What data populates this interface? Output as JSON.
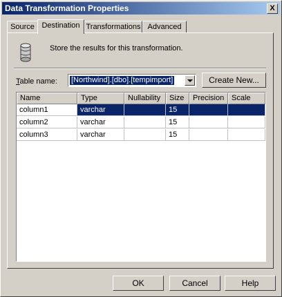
{
  "window": {
    "title": "Data Transformation Properties",
    "close_label": "X"
  },
  "tabs": [
    {
      "label": "Source"
    },
    {
      "label": "Destination",
      "active": true
    },
    {
      "label": "Transformations"
    },
    {
      "label": "Advanced"
    }
  ],
  "destination": {
    "description": "Store the results for this transformation.",
    "table_label_prefix": "T",
    "table_label_rest": "able name:",
    "table_name_value": "[Northwind].[dbo].[tempimport]",
    "create_new_label": "Create New..."
  },
  "grid": {
    "headers": [
      "Name",
      "Type",
      "Nullability",
      "Size",
      "Precision",
      "Scale"
    ],
    "rows": [
      {
        "name": "column1",
        "type": "varchar",
        "nullability": "",
        "size": "15",
        "precision": "",
        "scale": ""
      },
      {
        "name": "column2",
        "type": "varchar",
        "nullability": "",
        "size": "15",
        "precision": "",
        "scale": ""
      },
      {
        "name": "column3",
        "type": "varchar",
        "nullability": "",
        "size": "15",
        "precision": "",
        "scale": ""
      }
    ]
  },
  "buttons": {
    "ok": "OK",
    "cancel": "Cancel",
    "help": "Help"
  },
  "colors": {
    "title_bar": "#0a246a",
    "selection": "#0a246a",
    "face": "#d4d0c8"
  },
  "icons": {
    "table": "database-icon"
  }
}
